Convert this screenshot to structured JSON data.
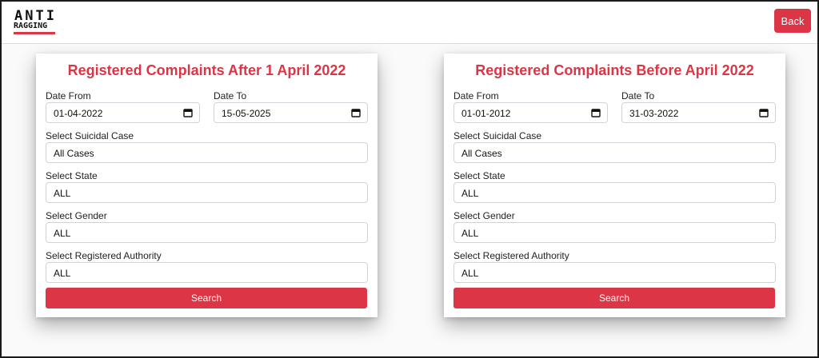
{
  "header": {
    "logo_line1": "ANTI",
    "logo_line2": "RAGGING",
    "back_label": "Back"
  },
  "colors": {
    "accent": "#dc3545",
    "border": "#ced4da"
  },
  "cards": [
    {
      "title": "Registered Complaints After 1 April 2022",
      "date_from_label": "Date From",
      "date_from_value": "01-04-2022",
      "date_to_label": "Date To",
      "date_to_value": "15-05-2025",
      "suicidal_label": "Select Suicidal Case",
      "suicidal_value": "All Cases",
      "state_label": "Select State",
      "state_value": "ALL",
      "gender_label": "Select Gender",
      "gender_value": "ALL",
      "authority_label": "Select Registered Authority",
      "authority_value": "ALL",
      "search_label": "Search"
    },
    {
      "title": "Registered Complaints Before April 2022",
      "date_from_label": "Date From",
      "date_from_value": "01-01-2012",
      "date_to_label": "Date To",
      "date_to_value": "31-03-2022",
      "suicidal_label": "Select Suicidal Case",
      "suicidal_value": "All Cases",
      "state_label": "Select State",
      "state_value": "ALL",
      "gender_label": "Select Gender",
      "gender_value": "ALL",
      "authority_label": "Select Registered Authority",
      "authority_value": "ALL",
      "search_label": "Search"
    }
  ]
}
